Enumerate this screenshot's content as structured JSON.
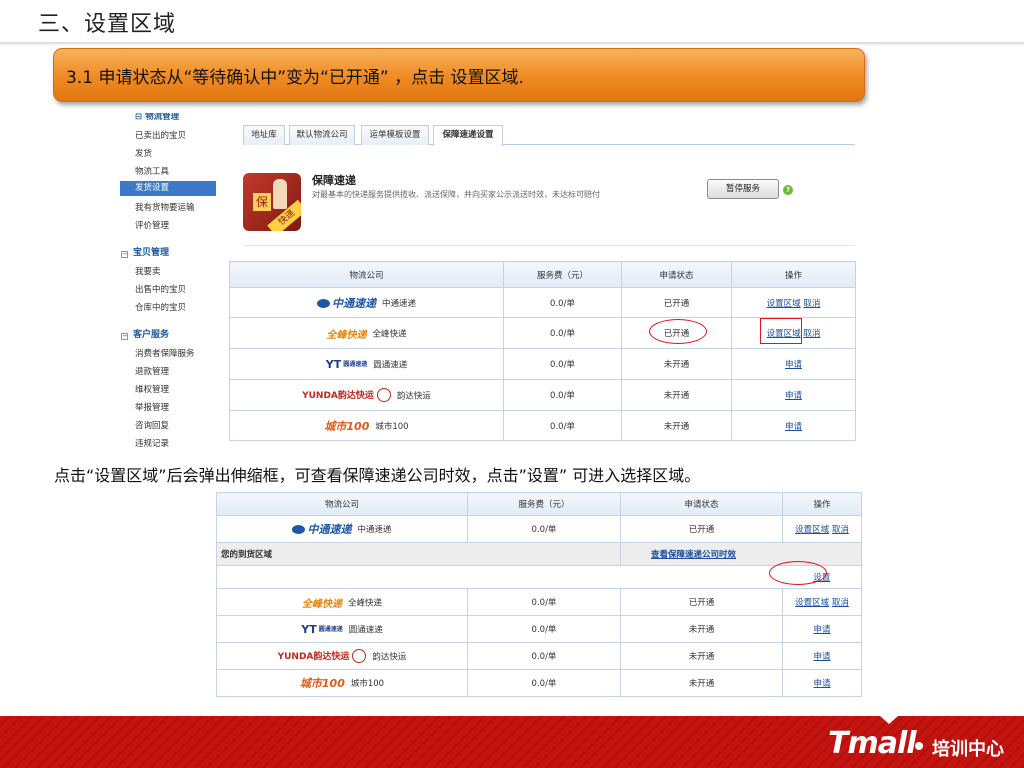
{
  "slide": {
    "title": "三、设置区域",
    "step_banner": "3.1 申请状态从“等待确认中”变为“已开通” ，点击 设置区域.",
    "note": "点击“设置区域”后会弹出伸缩框，可查看保障速递公司时效，点击”设置” 可进入选择区域。"
  },
  "sidebar": {
    "top_items": [
      "已卖出的宝贝",
      "发货",
      "物流工具",
      "发货设置",
      "我有货物要运输",
      "评价管理"
    ],
    "active_item": "发货设置",
    "section_baby": {
      "heading": "宝贝管理",
      "items": [
        "我要卖",
        "出售中的宝贝",
        "仓库中的宝贝"
      ]
    },
    "section_customer": {
      "heading": "客户服务",
      "items": [
        "消费者保障服务",
        "退款管理",
        "维权管理",
        "举报管理",
        "咨询回复",
        "违规记录"
      ]
    }
  },
  "tabs": [
    "地址库",
    "默认物流公司",
    "运单模板设置",
    "保障速递设置"
  ],
  "active_tab": "保障速递设置",
  "insurance": {
    "logo_text_bao": "保",
    "logo_text_kuai": "快递",
    "name": "保障速递",
    "description": "对最基本的快递服务提供揽收、派送保障，并向买家公示派送时效，未达标可赔付",
    "pause_button": "暂停服务",
    "help_icon": "?"
  },
  "table1": {
    "headers": [
      "物流公司",
      "服务费（元）",
      "申请状态",
      "操作"
    ],
    "rows": [
      {
        "logo": "中通速递",
        "name": "中通速递",
        "fee": "0.0/单",
        "status": "已开通",
        "status_on": true,
        "ops": [
          "设置区域",
          "取消"
        ]
      },
      {
        "logo": "全峰快递",
        "name": "全峰快递",
        "fee": "0.0/单",
        "status": "已开通",
        "status_on": true,
        "ops": [
          "设置区域",
          "取消"
        ]
      },
      {
        "logo": "YT",
        "logo_cn": "圆通速递",
        "name": "圆通速递",
        "fee": "0.0/单",
        "status": "未开通",
        "status_on": false,
        "ops": [
          "申请"
        ]
      },
      {
        "logo": "YUNDA韵达快运",
        "name": "韵达快运",
        "fee": "0.0/单",
        "status": "未开通",
        "status_on": false,
        "ops": [
          "申请"
        ]
      },
      {
        "logo": "城市100",
        "name": "城市100",
        "fee": "0.0/单",
        "status": "未开通",
        "status_on": false,
        "ops": [
          "申请"
        ]
      }
    ]
  },
  "table2": {
    "headers": [
      "物流公司",
      "服务费（元）",
      "申请状态",
      "操作"
    ],
    "first_row": {
      "logo": "中通速递",
      "name": "中通速递",
      "fee": "0.0/单",
      "status": "已开通",
      "ops": [
        "设置区域",
        "取消"
      ]
    },
    "region_label": "您的到货区域",
    "region_link": "查看保障速递公司时效",
    "set_link": "设置",
    "rows": [
      {
        "logo": "全峰快递",
        "name": "全峰快递",
        "fee": "0.0/单",
        "status": "已开通",
        "status_on": true,
        "ops": [
          "设置区域",
          "取消"
        ]
      },
      {
        "logo": "YT",
        "logo_cn": "圆通速递",
        "name": "圆通速递",
        "fee": "0.0/单",
        "status": "未开通",
        "status_on": false,
        "ops": [
          "申请"
        ]
      },
      {
        "logo": "YUNDA韵达快运",
        "name": "韵达快运",
        "fee": "0.0/单",
        "status": "未开通",
        "status_on": false,
        "ops": [
          "申请"
        ]
      },
      {
        "logo": "城市100",
        "name": "城市100",
        "fee": "0.0/单",
        "status": "未开通",
        "status_on": false,
        "ops": [
          "申请"
        ]
      }
    ]
  },
  "footer": {
    "brand": "Tmall",
    "subtitle": "培训中心"
  },
  "colors": {
    "banner": "#ef8a21",
    "footer": "#c41410",
    "link": "#1a4fa1",
    "status_on": "#2c9c2c",
    "highlight": "#e0141c"
  }
}
